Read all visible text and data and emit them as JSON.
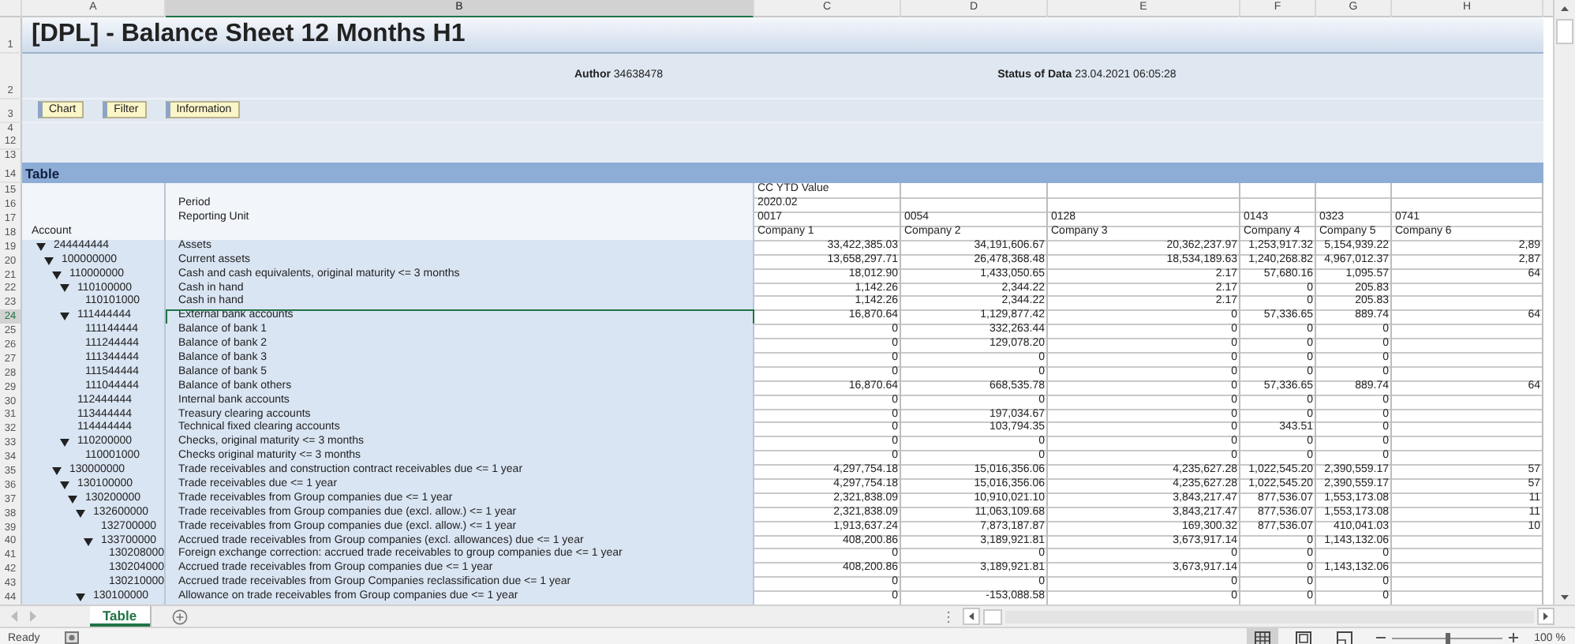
{
  "column_headers": [
    {
      "label": "A",
      "selected": false
    },
    {
      "label": "B",
      "selected": true
    },
    {
      "label": "C",
      "selected": false
    },
    {
      "label": "D",
      "selected": false
    },
    {
      "label": "E",
      "selected": false
    },
    {
      "label": "F",
      "selected": false
    },
    {
      "label": "G",
      "selected": false
    },
    {
      "label": "H",
      "selected": false
    }
  ],
  "report": {
    "title_row": "1",
    "title": "[DPL] - Balance Sheet 12 Months H1",
    "meta_row": "2",
    "author_label": "Author",
    "author": "34638478",
    "status_label": "Status of Data",
    "status": "23.04.2021 06:05:28",
    "buttons_row": "3",
    "buttons": [
      {
        "label": "Chart"
      },
      {
        "label": "Filter"
      },
      {
        "label": "Information"
      }
    ],
    "spacer_rows": [
      "4",
      "12",
      "13"
    ],
    "section_row": "14",
    "section_title": "Table"
  },
  "header_rows": [
    {
      "row": "15",
      "values": [
        "CC YTD Value"
      ]
    },
    {
      "row": "16",
      "label": "Period",
      "values": [
        "2020.02"
      ]
    },
    {
      "row": "17",
      "label": "Reporting Unit",
      "values": [
        "0017",
        "0054",
        "0128",
        "0143",
        "0323",
        "0741"
      ]
    },
    {
      "row": "18",
      "account": "Account",
      "values": [
        "Company 1",
        "Company 2",
        "Company 3",
        "Company 4",
        "Company 5",
        "Company 6"
      ]
    }
  ],
  "accounts": [
    {
      "row": "19",
      "account": "244444444",
      "description": "Assets",
      "expanded": true,
      "selected": false,
      "values": [
        "33,422,385.03",
        "34,191,606.67",
        "20,362,237.97",
        "1,253,917.32",
        "5,154,939.22",
        "2,89"
      ],
      "children": [
        {
          "row": "20",
          "account": "100000000",
          "description": "Current assets",
          "expanded": true,
          "selected": false,
          "values": [
            "13,658,297.71",
            "26,478,368.48",
            "18,534,189.63",
            "1,240,268.82",
            "4,967,012.37",
            "2,87"
          ],
          "children": [
            {
              "row": "21",
              "account": "110000000",
              "description": "Cash and cash equivalents, original maturity <= 3 months",
              "expanded": true,
              "selected": false,
              "values": [
                "18,012.90",
                "1,433,050.65",
                "2.17",
                "57,680.16",
                "1,095.57",
                "64"
              ],
              "children": [
                {
                  "row": "22",
                  "account": "110100000",
                  "description": "Cash in hand",
                  "expanded": true,
                  "selected": false,
                  "values": [
                    "1,142.26",
                    "2,344.22",
                    "2.17",
                    "0",
                    "205.83"
                  ],
                  "children": [
                    {
                      "row": "23",
                      "account": "110101000",
                      "description": "Cash in hand",
                      "selected": false,
                      "values": [
                        "1,142.26",
                        "2,344.22",
                        "2.17",
                        "0",
                        "205.83"
                      ]
                    }
                  ]
                },
                {
                  "row": "24",
                  "account": "111444444",
                  "description": "External bank accounts",
                  "expanded": true,
                  "selected": true,
                  "values": [
                    "16,870.64",
                    "1,129,877.42",
                    "0",
                    "57,336.65",
                    "889.74",
                    "64"
                  ],
                  "children": [
                    {
                      "row": "25",
                      "account": "111144444",
                      "description": "Balance of bank 1",
                      "selected": false,
                      "values": [
                        "0",
                        "332,263.44",
                        "0",
                        "0",
                        "0"
                      ]
                    },
                    {
                      "row": "26",
                      "account": "111244444",
                      "description": "Balance of bank 2",
                      "selected": false,
                      "values": [
                        "0",
                        "129,078.20",
                        "0",
                        "0",
                        "0"
                      ]
                    },
                    {
                      "row": "27",
                      "account": "111344444",
                      "description": "Balance of bank 3",
                      "selected": false,
                      "values": [
                        "0",
                        "0",
                        "0",
                        "0",
                        "0"
                      ]
                    },
                    {
                      "row": "28",
                      "account": "111544444",
                      "description": "Balance of bank 5",
                      "selected": false,
                      "values": [
                        "0",
                        "0",
                        "0",
                        "0",
                        "0"
                      ]
                    },
                    {
                      "row": "29",
                      "account": "111044444",
                      "description": "Balance of bank others",
                      "selected": false,
                      "values": [
                        "16,870.64",
                        "668,535.78",
                        "0",
                        "57,336.65",
                        "889.74",
                        "64"
                      ]
                    }
                  ]
                },
                {
                  "row": "30",
                  "account": "112444444",
                  "description": "Internal bank accounts",
                  "selected": false,
                  "values": [
                    "0",
                    "0",
                    "0",
                    "0",
                    "0"
                  ]
                },
                {
                  "row": "31",
                  "account": "113444444",
                  "description": "Treasury clearing accounts",
                  "selected": false,
                  "values": [
                    "0",
                    "197,034.67",
                    "0",
                    "0",
                    "0"
                  ]
                },
                {
                  "row": "32",
                  "account": "114444444",
                  "description": "Technical fixed clearing accounts",
                  "selected": false,
                  "values": [
                    "0",
                    "103,794.35",
                    "0",
                    "343.51",
                    "0"
                  ]
                },
                {
                  "row": "33",
                  "account": "110200000",
                  "description": "Checks, original maturity <= 3 months",
                  "expanded": true,
                  "selected": false,
                  "values": [
                    "0",
                    "0",
                    "0",
                    "0",
                    "0"
                  ],
                  "children": [
                    {
                      "row": "34",
                      "account": "110001000",
                      "description": "Checks original maturity <= 3 months",
                      "selected": false,
                      "values": [
                        "0",
                        "0",
                        "0",
                        "0",
                        "0"
                      ]
                    }
                  ]
                }
              ]
            },
            {
              "row": "35",
              "account": "130000000",
              "description": "Trade receivables and construction contract receivables due <= 1 year",
              "expanded": true,
              "selected": false,
              "values": [
                "4,297,754.18",
                "15,016,356.06",
                "4,235,627.28",
                "1,022,545.20",
                "2,390,559.17",
                "57"
              ],
              "children": [
                {
                  "row": "36",
                  "account": "130100000",
                  "description": "Trade receivables due <= 1 year",
                  "expanded": true,
                  "selected": false,
                  "values": [
                    "4,297,754.18",
                    "15,016,356.06",
                    "4,235,627.28",
                    "1,022,545.20",
                    "2,390,559.17",
                    "57"
                  ],
                  "children": [
                    {
                      "row": "37",
                      "account": "130200000",
                      "description": "Trade receivables from Group companies due <= 1 year",
                      "expanded": true,
                      "selected": false,
                      "values": [
                        "2,321,838.09",
                        "10,910,021.10",
                        "3,843,217.47",
                        "877,536.07",
                        "1,553,173.08",
                        "11"
                      ],
                      "children": [
                        {
                          "row": "38",
                          "account": "132600000",
                          "description": "Trade receivables from Group companies due (excl. allow.) <= 1 year",
                          "expanded": true,
                          "selected": false,
                          "values": [
                            "2,321,838.09",
                            "11,063,109.68",
                            "3,843,217.47",
                            "877,536.07",
                            "1,553,173.08",
                            "11"
                          ],
                          "children": [
                            {
                              "row": "39",
                              "account": "132700000",
                              "description": "Trade receivables from Group companies due (excl. allow.) <= 1 year",
                              "selected": false,
                              "values": [
                                "1,913,637.24",
                                "7,873,187.87",
                                "169,300.32",
                                "877,536.07",
                                "410,041.03",
                                "10"
                              ]
                            },
                            {
                              "row": "40",
                              "account": "133700000",
                              "description": "Accrued trade receivables from Group companies (excl. allowances) due <= 1 year",
                              "expanded": true,
                              "selected": false,
                              "values": [
                                "408,200.86",
                                "3,189,921.81",
                                "3,673,917.14",
                                "0",
                                "1,143,132.06"
                              ],
                              "children": [
                                {
                                  "row": "41",
                                  "account": "130208000",
                                  "description": "Foreign exchange correction: accrued trade receivables to group companies due <= 1 year",
                                  "selected": false,
                                  "values": [
                                    "0",
                                    "0",
                                    "0",
                                    "0",
                                    "0"
                                  ]
                                },
                                {
                                  "row": "42",
                                  "account": "130204000",
                                  "description": "Accrued trade receivables from Group companies due <= 1 year",
                                  "selected": false,
                                  "values": [
                                    "408,200.86",
                                    "3,189,921.81",
                                    "3,673,917.14",
                                    "0",
                                    "1,143,132.06"
                                  ]
                                },
                                {
                                  "row": "43",
                                  "account": "130210000",
                                  "description": "Accrued trade receivables from Group Companies reclassification due <= 1 year",
                                  "selected": false,
                                  "values": [
                                    "0",
                                    "0",
                                    "0",
                                    "0",
                                    "0"
                                  ]
                                }
                              ]
                            }
                          ]
                        },
                        {
                          "row": "44",
                          "account": "130100000",
                          "description": "Allowance on trade receivables from Group companies due <= 1 year",
                          "expanded": true,
                          "selected": false,
                          "values": [
                            "0",
                            "-153,088.58",
                            "0",
                            "0",
                            "0"
                          ]
                        }
                      ]
                    }
                  ]
                }
              ]
            }
          ]
        }
      ]
    }
  ],
  "sheet_tabs": [
    {
      "label": "Table",
      "selected": true
    }
  ],
  "status_bar": {
    "status": "Ready",
    "views": [
      {
        "kind": "normal",
        "selected": true
      },
      {
        "kind": "page-layout",
        "selected": false
      },
      {
        "kind": "page-break",
        "selected": false
      }
    ],
    "zoom_slider": {
      "level": 0.5
    },
    "zoom": "100 %"
  }
}
